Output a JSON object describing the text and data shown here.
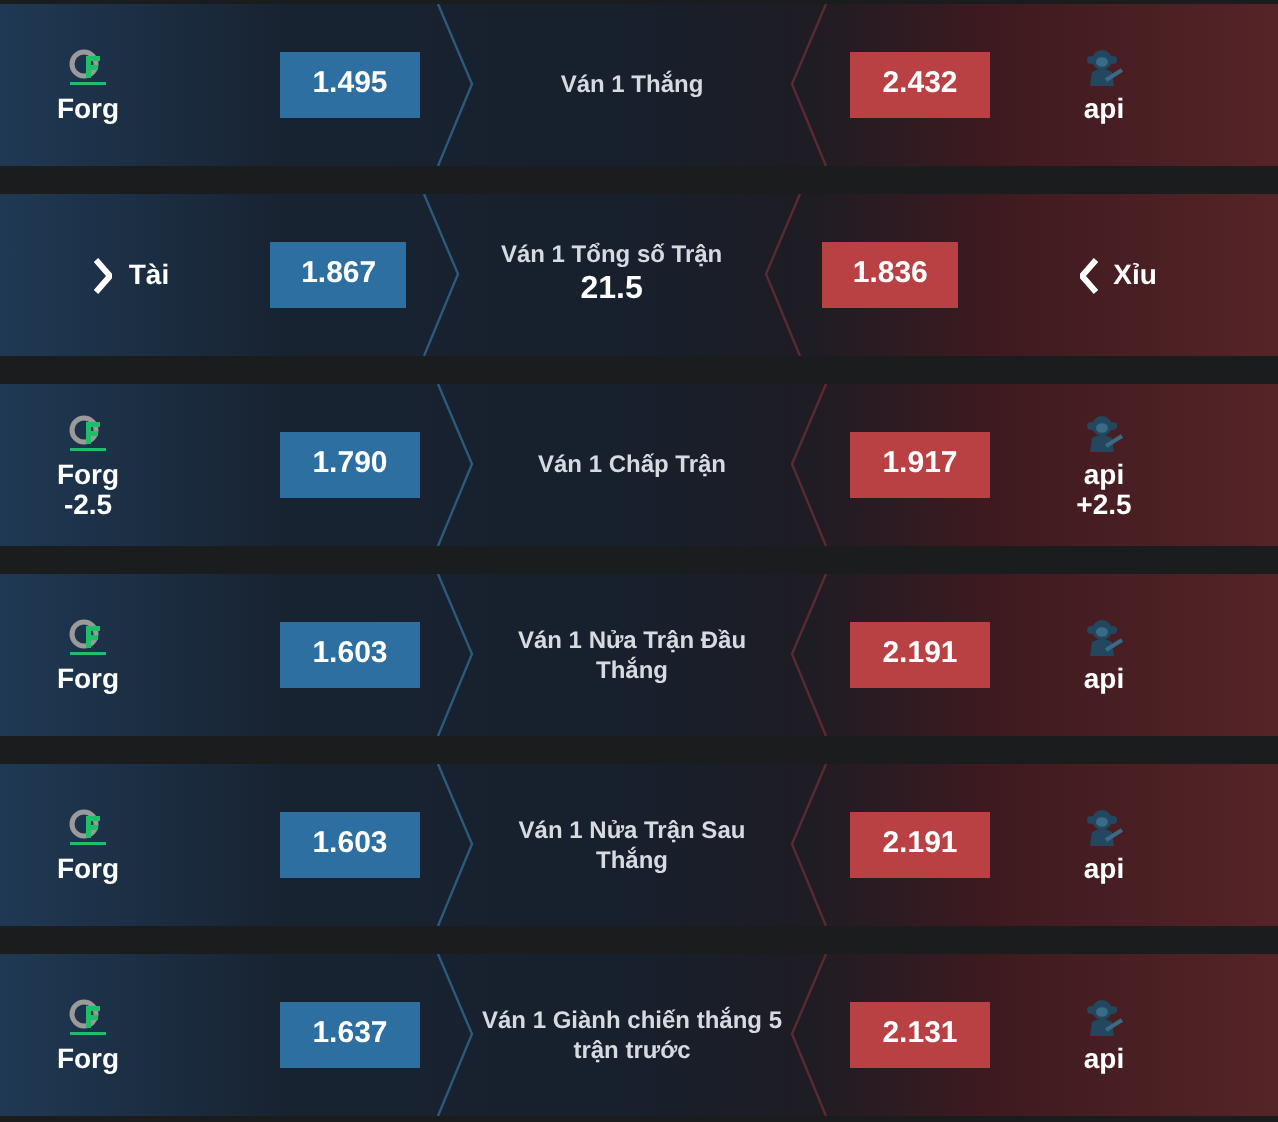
{
  "markets": [
    {
      "home": {
        "kind": "team",
        "name": "Forg"
      },
      "home_odds": "1.495",
      "title": "Ván 1 Thắng",
      "away_odds": "2.432",
      "away": {
        "kind": "team",
        "name": "api"
      }
    },
    {
      "home": {
        "kind": "over",
        "name": "Tài"
      },
      "home_odds": "1.867",
      "title": "Ván 1 Tổng số Trận",
      "line": "21.5",
      "away_odds": "1.836",
      "away": {
        "kind": "under",
        "name": "Xỉu"
      }
    },
    {
      "home": {
        "kind": "team",
        "name": "Forg",
        "handicap": "-2.5"
      },
      "home_odds": "1.790",
      "title": "Ván 1 Chấp Trận",
      "away_odds": "1.917",
      "away": {
        "kind": "team",
        "name": "api",
        "handicap": "+2.5"
      }
    },
    {
      "home": {
        "kind": "team",
        "name": "Forg"
      },
      "home_odds": "1.603",
      "title": "Ván 1 Nửa Trận Đầu Thắng",
      "away_odds": "2.191",
      "away": {
        "kind": "team",
        "name": "api"
      }
    },
    {
      "home": {
        "kind": "team",
        "name": "Forg"
      },
      "home_odds": "1.603",
      "title": "Ván 1 Nửa Trận Sau Thắng",
      "away_odds": "2.191",
      "away": {
        "kind": "team",
        "name": "api"
      }
    },
    {
      "home": {
        "kind": "team",
        "name": "Forg"
      },
      "home_odds": "1.637",
      "title": "Ván 1 Giành chiến thắng 5 trận trước",
      "away_odds": "2.131",
      "away": {
        "kind": "team",
        "name": "api"
      }
    }
  ]
}
